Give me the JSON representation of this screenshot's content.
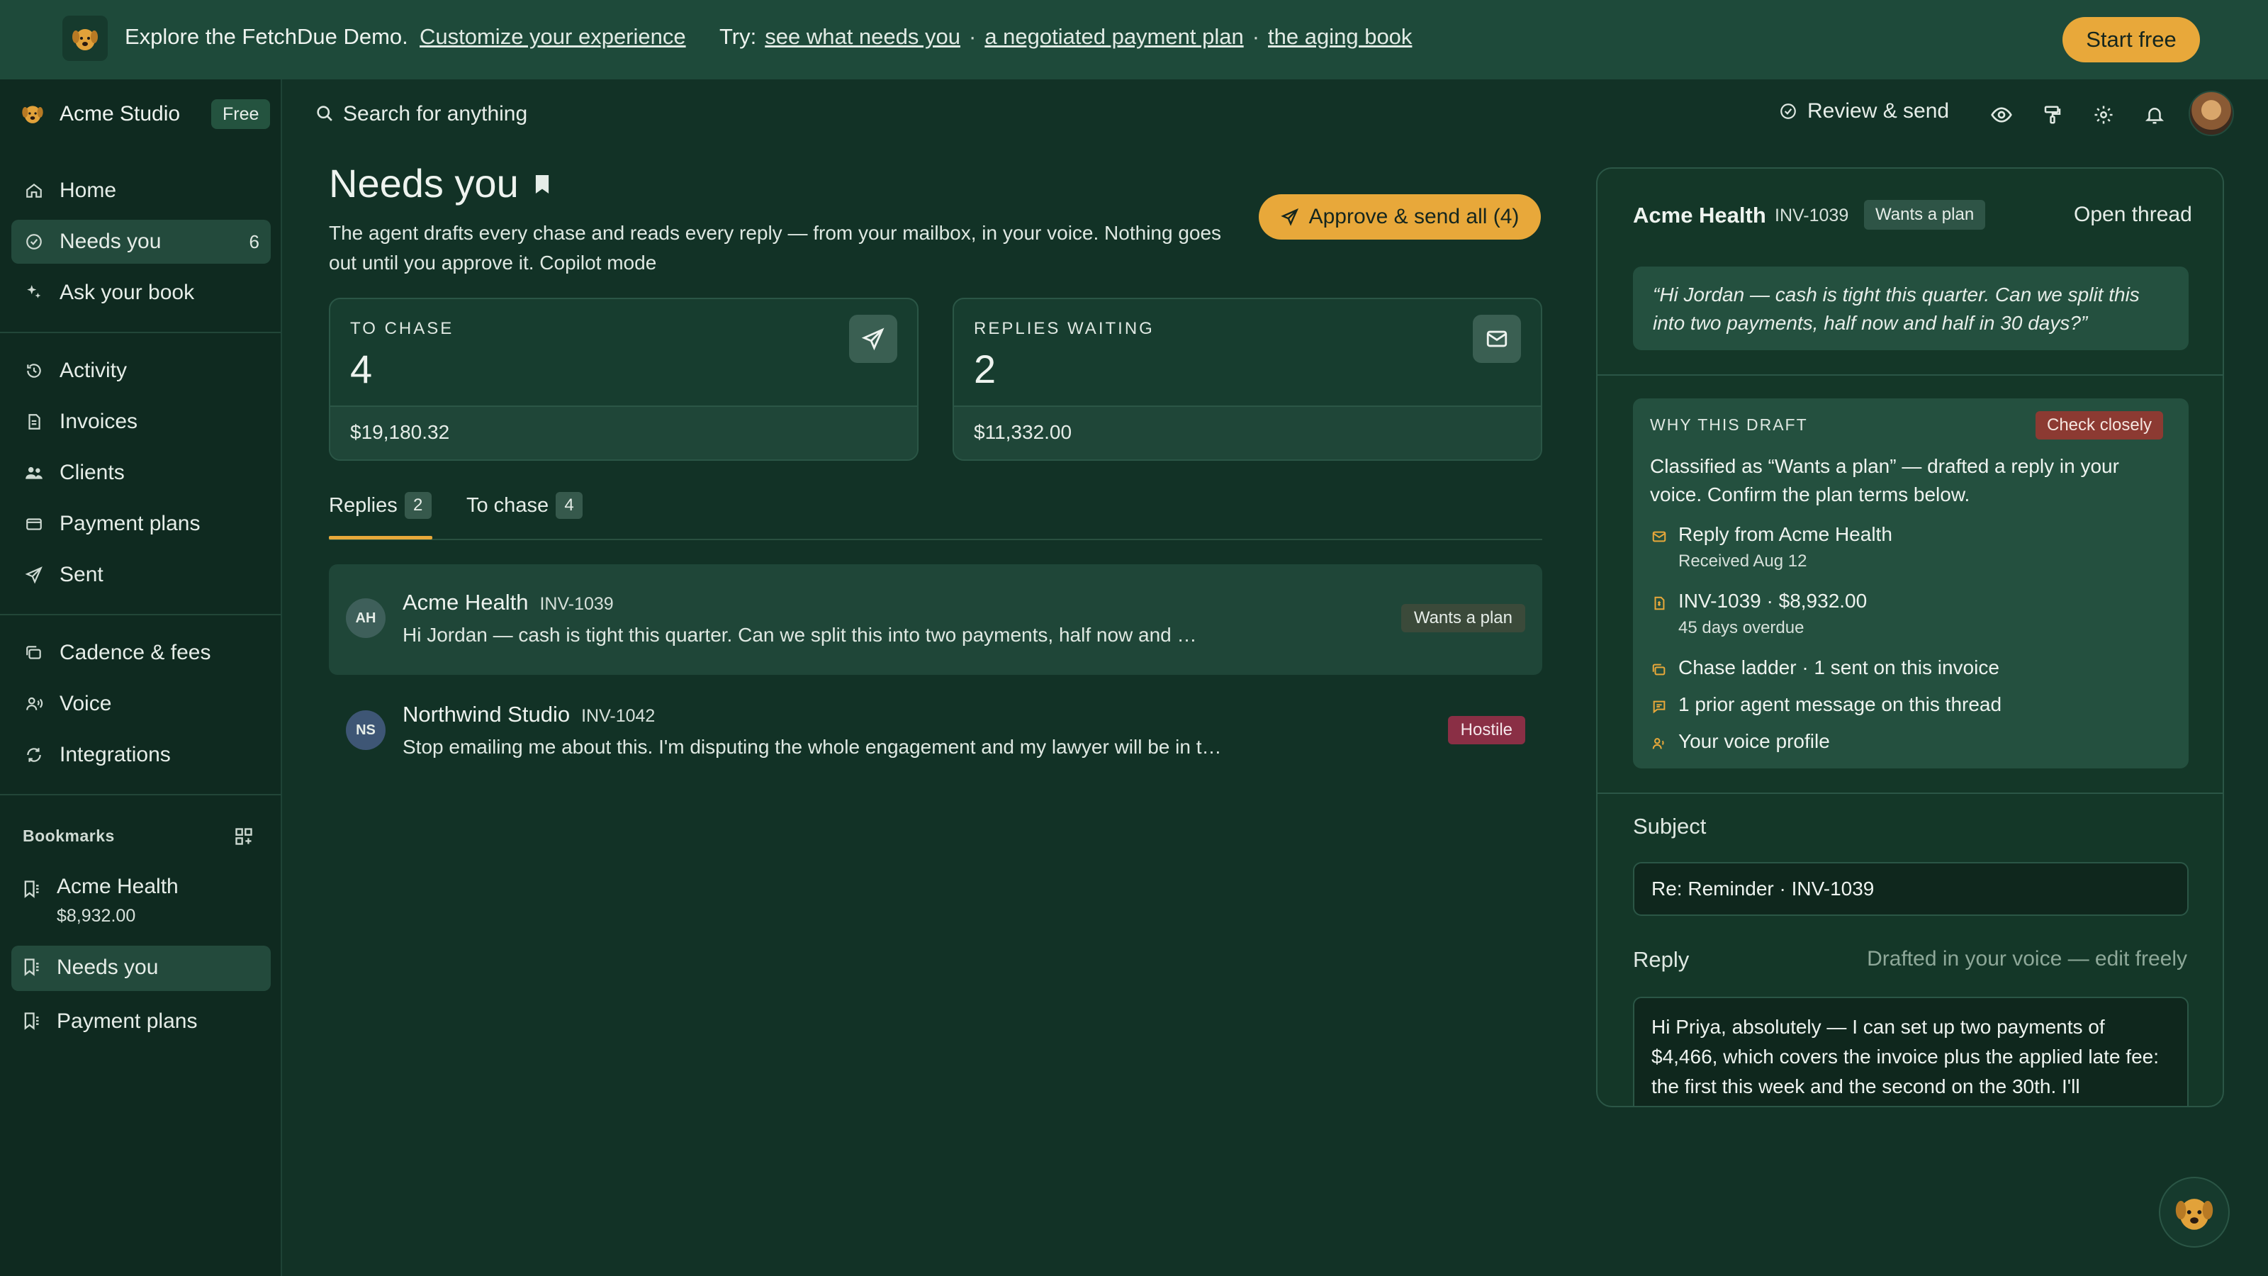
{
  "banner": {
    "lead": "Explore the FetchDue Demo.",
    "customize": "Customize your experience",
    "try_label": "Try:",
    "try_links": [
      "see what needs you",
      "a negotiated payment plan",
      "the aging book"
    ],
    "start_free": "Start free"
  },
  "workspace": {
    "name": "Acme Studio",
    "plan": "Free"
  },
  "sidebar": {
    "primary": [
      {
        "label": "Home",
        "icon": "home-icon"
      },
      {
        "label": "Needs you",
        "icon": "check-circle-icon",
        "count": "6",
        "active": true
      },
      {
        "label": "Ask your book",
        "icon": "sparkle-icon"
      }
    ],
    "records": [
      {
        "label": "Activity",
        "icon": "history-icon"
      },
      {
        "label": "Invoices",
        "icon": "invoice-icon"
      },
      {
        "label": "Clients",
        "icon": "users-icon"
      },
      {
        "label": "Payment plans",
        "icon": "credit-card-icon"
      },
      {
        "label": "Sent",
        "icon": "send-icon"
      }
    ],
    "settings": [
      {
        "label": "Cadence & fees",
        "icon": "layers-icon"
      },
      {
        "label": "Voice",
        "icon": "voice-icon"
      },
      {
        "label": "Integrations",
        "icon": "refresh-icon"
      }
    ],
    "bookmarks_title": "Bookmarks",
    "bookmarks": [
      {
        "label": "Acme Health",
        "sub": "$8,932.00"
      },
      {
        "label": "Needs you",
        "active": true
      },
      {
        "label": "Payment plans"
      }
    ]
  },
  "topbar": {
    "search_placeholder": "Search for anything",
    "review_send": "Review & send"
  },
  "main": {
    "title": "Needs you",
    "description": "The agent drafts every chase and reads every reply — from your mailbox, in your voice. Nothing goes out until you approve it. Copilot mode",
    "approve_all": "Approve & send all (4)",
    "stats": [
      {
        "label": "TO CHASE",
        "value": "4",
        "amount": "$19,180.32",
        "icon": "send-icon"
      },
      {
        "label": "REPLIES WAITING",
        "value": "2",
        "amount": "$11,332.00",
        "icon": "mail-icon"
      }
    ],
    "tabs": [
      {
        "label": "Replies",
        "count": "2",
        "active": true
      },
      {
        "label": "To chase",
        "count": "4"
      }
    ],
    "replies": [
      {
        "initials": "AH",
        "name": "Acme Health",
        "invoice": "INV-1039",
        "preview": "Hi Jordan — cash is tight this quarter. Can we split this into two payments, half now and …",
        "tag": "Wants a plan",
        "tag_color": "#3b4a3a",
        "avatar_color": "#3e5f5a"
      },
      {
        "initials": "NS",
        "name": "Northwind Studio",
        "invoice": "INV-1042",
        "preview": "Stop emailing me about this. I'm disputing the whole engagement and my lawyer will be in t…",
        "tag": "Hostile",
        "tag_color": "#8a2f45",
        "avatar_color": "#3e5675"
      }
    ]
  },
  "panel": {
    "client": "Acme Health",
    "invoice": "INV-1039",
    "tag": "Wants a plan",
    "open_thread": "Open thread",
    "quote": "“Hi Jordan — cash is tight this quarter. Can we split this into two payments, half now and half in 30 days?”",
    "why_title": "WHY THIS DRAFT",
    "check_closely": "Check closely",
    "why_body": "Classified as “Wants a plan” — drafted a reply in your voice. Confirm the plan terms below.",
    "evidence": [
      {
        "icon": "mail-icon",
        "label": "Reply from Acme Health",
        "sub": "Received Aug 12"
      },
      {
        "icon": "invoice-icon",
        "label": "INV-1039 · $8,932.00",
        "sub": "45 days overdue"
      },
      {
        "icon": "layers-icon",
        "label": "Chase ladder · 1 sent on this invoice"
      },
      {
        "icon": "chat-icon",
        "label": "1 prior agent message on this thread"
      },
      {
        "icon": "voice-icon",
        "label": "Your voice profile"
      }
    ],
    "subject_label": "Subject",
    "subject_value": "Re: Reminder · INV-1039",
    "reply_label": "Reply",
    "reply_hint": "Drafted in your voice — edit freely",
    "reply_value": "Hi Priya, absolutely — I can set up two payments of $4,466, which covers the invoice plus the applied late fee: the first this week and the second on the 30th. I'll"
  },
  "colors": {
    "accent": "#e8a83a",
    "background": "#123226",
    "banner": "#1e4a3a",
    "sidebar": "#0f2a20",
    "danger": "#8c3a32"
  }
}
